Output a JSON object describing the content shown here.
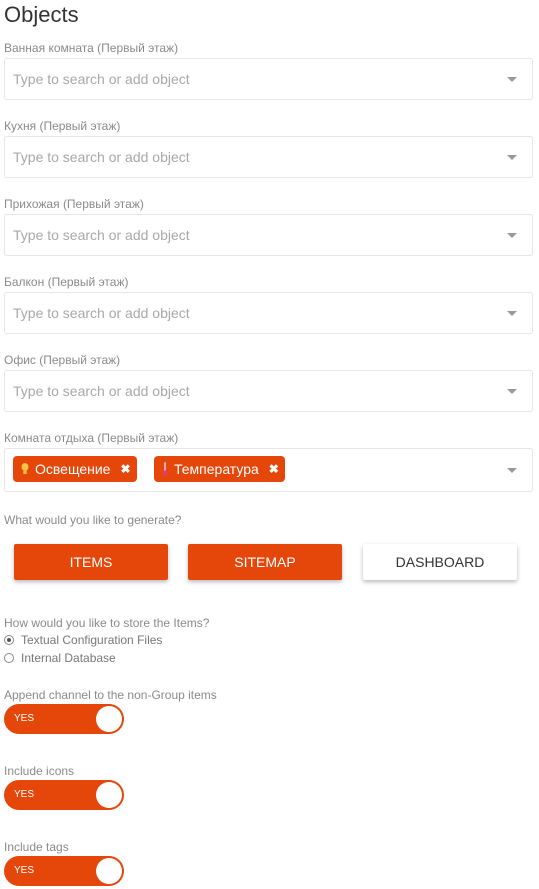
{
  "title": "Objects",
  "colors": {
    "accent": "#e5470b",
    "label": "#8a8a8a",
    "placeholder": "#a8a8a8"
  },
  "locations": [
    {
      "label": "Ванная комната (Первый этаж)",
      "placeholder": "Type to search or add object"
    },
    {
      "label": "Кухня (Первый этаж)",
      "placeholder": "Type to search or add object"
    },
    {
      "label": "Прихожая (Первый этаж)",
      "placeholder": "Type to search or add object"
    },
    {
      "label": "Балкон (Первый этаж)",
      "placeholder": "Type to search or add object"
    },
    {
      "label": "Офис (Первый этаж)",
      "placeholder": "Type to search or add object"
    },
    {
      "label": "Комната отдыха (Первый этаж)",
      "tags": [
        {
          "label": "Освещение",
          "icon": "lightbulb-icon"
        },
        {
          "label": "Температура",
          "icon": "thermometer-icon"
        }
      ]
    }
  ],
  "generate": {
    "question": "What would you like to generate?",
    "options": [
      {
        "label": "ITEMS",
        "selected": true
      },
      {
        "label": "SITEMAP",
        "selected": true
      },
      {
        "label": "DASHBOARD",
        "selected": false
      }
    ]
  },
  "storage": {
    "question": "How would you like to store the Items?",
    "options": [
      {
        "label": "Textual Configuration Files",
        "checked": true
      },
      {
        "label": "Internal Database",
        "checked": false
      }
    ]
  },
  "toggles": [
    {
      "label": "Append channel to the non-Group items",
      "value": "YES"
    },
    {
      "label": "Include icons",
      "value": "YES"
    },
    {
      "label": "Include tags",
      "value": "YES"
    }
  ]
}
